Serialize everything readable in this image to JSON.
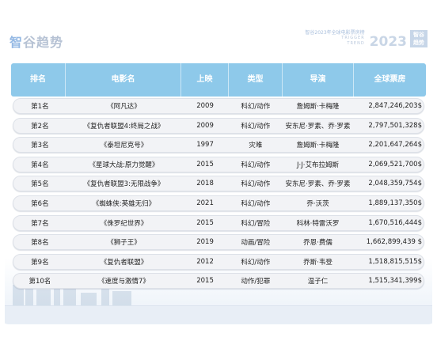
{
  "logo": {
    "mark": "智",
    "text": "谷趋势"
  },
  "brand": {
    "caption": "智谷2023年全球电影票房榜",
    "sub1": "TRIGGER",
    "sub2": "TREND",
    "year": "2023",
    "corner": "智谷\n趋势"
  },
  "table": {
    "headers": [
      "排名",
      "电影名",
      "上映",
      "类型",
      "导演",
      "全球票房"
    ],
    "rows": [
      {
        "rank": "第1名",
        "title": "《阿凡达》",
        "year": "2009",
        "genre": "科幻/动作",
        "director": "詹姆斯·卡梅隆",
        "gross": "2,847,246,203$"
      },
      {
        "rank": "第2名",
        "title": "《复仇者联盟4:终局之战》",
        "year": "2009",
        "genre": "科幻/动作",
        "director": "安东尼·罗素、乔·罗素",
        "gross": "2,797,501,328$"
      },
      {
        "rank": "第3名",
        "title": "《泰坦尼克号》",
        "year": "1997",
        "genre": "灾难",
        "director": "詹姆斯·卡梅隆",
        "gross": "2,201,647,264$"
      },
      {
        "rank": "第4名",
        "title": "《星球大战:原力觉醒》",
        "year": "2015",
        "genre": "科幻/动作",
        "director": "J·J·艾布拉姆斯",
        "gross": "2,069,521,700$"
      },
      {
        "rank": "第5名",
        "title": "《复仇者联盟3:无限战争》",
        "year": "2018",
        "genre": "科幻/动作",
        "director": "安东尼·罗素、乔·罗素",
        "gross": "2,048,359,754$"
      },
      {
        "rank": "第6名",
        "title": "《蜘蛛侠:英雄无归》",
        "year": "2021",
        "genre": "科幻/动作",
        "director": "乔·沃茨",
        "gross": "1,889,137,350$"
      },
      {
        "rank": "第7名",
        "title": "《侏罗纪世界》",
        "year": "2015",
        "genre": "科幻/冒险",
        "director": "科林·特雷沃罗",
        "gross": "1,670,516,444$"
      },
      {
        "rank": "第8名",
        "title": "《狮子王》",
        "year": "2019",
        "genre": "动画/冒险",
        "director": "乔恩·费儒",
        "gross": "1,662,899,439 $"
      },
      {
        "rank": "第9名",
        "title": "《复仇者联盟》",
        "year": "2012",
        "genre": "科幻/动作",
        "director": "乔斯·韦登",
        "gross": "1,518,815,515$"
      },
      {
        "rank": "第10名",
        "title": "《速度与激情7》",
        "year": "2015",
        "genre": "动作/犯罪",
        "director": "温子仁",
        "gross": "1,515,341,399$"
      }
    ]
  }
}
